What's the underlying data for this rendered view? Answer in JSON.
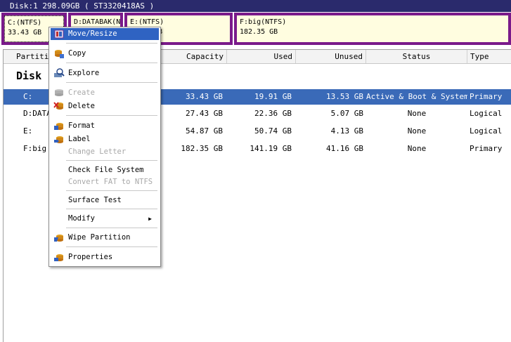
{
  "disk": {
    "title": "Disk:1  298.09GB  ( ST3320418AS )",
    "segments": [
      {
        "line1": "C:(NTFS)",
        "line2": "33.43 GB"
      },
      {
        "line1": "D:DATABAK(N",
        "line2": ""
      },
      {
        "line1": "E:(NTFS)",
        "line2": "B"
      },
      {
        "line1": "F:big(NTFS)",
        "line2": "182.35 GB"
      }
    ]
  },
  "table": {
    "columns": [
      "Partitio",
      "Capacity",
      "Used",
      "Unused",
      "Status",
      "Type"
    ],
    "group_title": "Disk",
    "rows": [
      {
        "partition": "C:",
        "capacity": "33.43 GB",
        "used": "19.91 GB",
        "unused": "13.53 GB",
        "status": "Active & Boot & System",
        "type": "Primary"
      },
      {
        "partition": "D:DATA",
        "capacity": "27.43 GB",
        "used": "22.36 GB",
        "unused": "5.07 GB",
        "status": "None",
        "type": "Logical"
      },
      {
        "partition": "E:",
        "capacity": "54.87 GB",
        "used": "50.74 GB",
        "unused": "4.13 GB",
        "status": "None",
        "type": "Logical"
      },
      {
        "partition": "F:big",
        "capacity": "182.35 GB",
        "used": "141.19 GB",
        "unused": "41.16 GB",
        "status": "None",
        "type": "Primary"
      }
    ]
  },
  "menu": {
    "move_resize": "Move/Resize",
    "copy": "Copy",
    "explore": "Explore",
    "create": "Create",
    "delete": "Delete",
    "format": "Format",
    "label": "Label",
    "change_letter": "Change Letter",
    "check_fs": "Check File System",
    "convert": "Convert FAT to NTFS",
    "surface_test": "Surface Test",
    "modify": "Modify",
    "modify_arrow": "▶",
    "wipe": "Wipe Partition",
    "properties": "Properties"
  },
  "icons": [
    "move-resize-icon",
    "copy-icon",
    "explore-icon",
    "create-icon",
    "delete-icon",
    "format-icon",
    "label-icon",
    "wipe-icon",
    "properties-icon"
  ],
  "colors": {
    "selection": "#3a6ab8",
    "menu_highlight": "#2f63c2",
    "partition_border": "#7a1a8a",
    "partition_fill": "#fffde0",
    "title_bar": "#2a2a6c"
  }
}
